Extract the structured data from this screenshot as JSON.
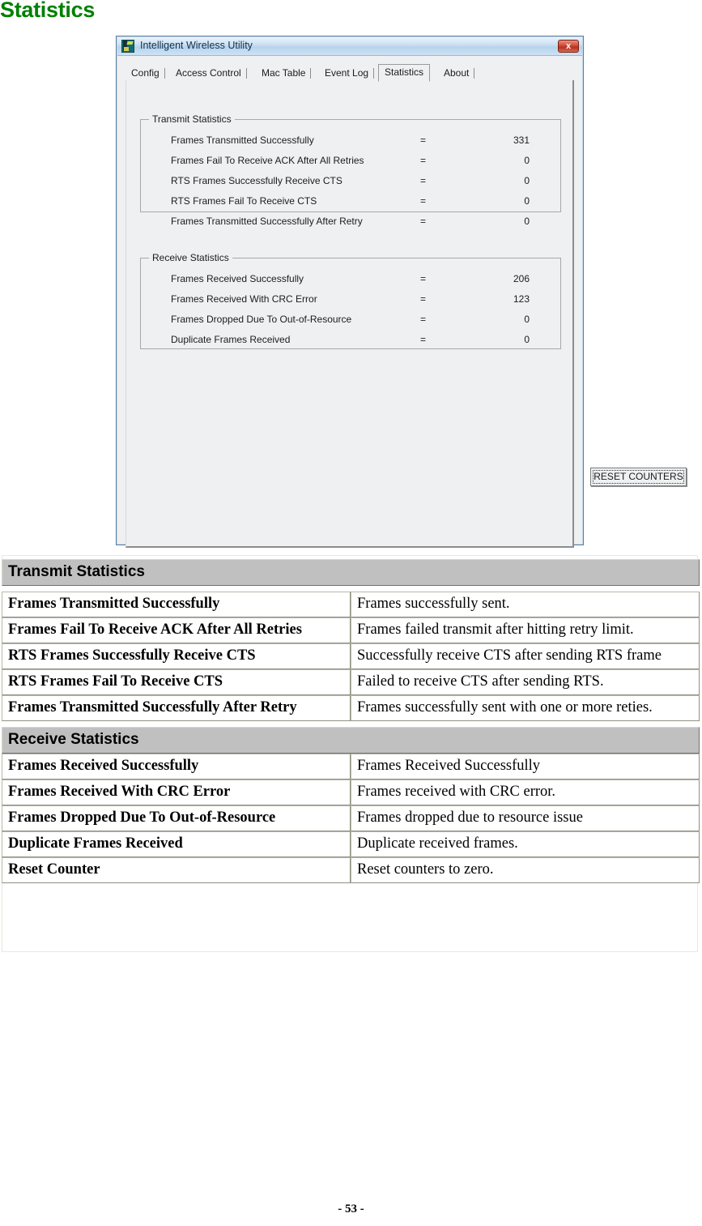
{
  "page": {
    "heading": "Statistics",
    "footer": "- 53 -"
  },
  "window": {
    "title": "Intelligent Wireless Utility",
    "icon": "wireless-utility-icon",
    "close_label": "x",
    "tabs": [
      {
        "label": "Config",
        "active": false
      },
      {
        "label": "Access Control",
        "active": false
      },
      {
        "label": "Mac Table",
        "active": false
      },
      {
        "label": "Event Log",
        "active": false
      },
      {
        "label": "Statistics",
        "active": true
      },
      {
        "label": "About",
        "active": false
      }
    ],
    "transmit_group": {
      "legend": "Transmit Statistics",
      "rows": [
        {
          "label": "Frames Transmitted Successfully",
          "eq": "=",
          "value": "331"
        },
        {
          "label": "Frames Fail To Receive ACK After All Retries",
          "eq": "=",
          "value": "0"
        },
        {
          "label": "RTS Frames Successfully Receive CTS",
          "eq": "=",
          "value": "0"
        },
        {
          "label": "RTS Frames Fail To Receive CTS",
          "eq": "=",
          "value": "0"
        },
        {
          "label": "Frames Transmitted Successfully After Retry",
          "eq": "=",
          "value": "0"
        }
      ]
    },
    "receive_group": {
      "legend": "Receive Statistics",
      "rows": [
        {
          "label": "Frames Received Successfully",
          "eq": "=",
          "value": "206"
        },
        {
          "label": "Frames Received With CRC Error",
          "eq": "=",
          "value": "123"
        },
        {
          "label": "Frames Dropped Due To Out-of-Resource",
          "eq": "=",
          "value": "0"
        },
        {
          "label": "Duplicate Frames Received",
          "eq": "=",
          "value": "0"
        }
      ]
    },
    "reset_button": "RESET COUNTERS"
  },
  "description_table": {
    "sections": [
      {
        "header": "Transmit Statistics",
        "rows": [
          {
            "term": "Frames Transmitted Successfully",
            "desc": "Frames successfully sent."
          },
          {
            "term": "Frames Fail To Receive ACK After All Retries",
            "desc": "Frames failed transmit after hitting retry limit."
          },
          {
            "term": "RTS Frames Successfully Receive CTS",
            "desc": "Successfully receive CTS after sending RTS frame"
          },
          {
            "term": "RTS Frames Fail To Receive CTS",
            "desc": "Failed to receive CTS after sending RTS."
          },
          {
            "term": "Frames Transmitted Successfully After Retry",
            "desc": "Frames successfully sent with one or more reties."
          }
        ]
      },
      {
        "header": "Receive Statistics",
        "rows": [
          {
            "term": "Frames Received Successfully",
            "desc": "Frames Received Successfully"
          },
          {
            "term": "Frames Received With CRC Error",
            "desc": "Frames received with CRC error."
          },
          {
            "term": "Frames Dropped Due To Out-of-Resource",
            "desc": "Frames dropped due to resource issue"
          },
          {
            "term": "Duplicate Frames Received",
            "desc": "Duplicate received frames."
          },
          {
            "term": "Reset Counter",
            "desc": "Reset counters to zero."
          }
        ]
      }
    ]
  },
  "colors": {
    "heading_green": "#008000",
    "section_gray": "#c0c0c0",
    "titlebar_blue": "#b6d3ec",
    "close_red": "#cf4a36"
  }
}
